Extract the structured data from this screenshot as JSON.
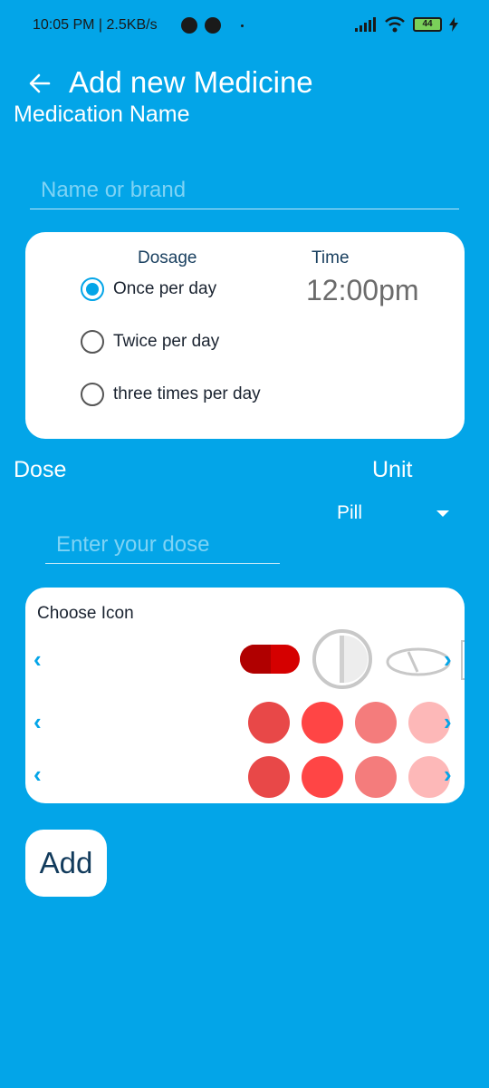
{
  "status_bar": {
    "time_speed": "10:05 PM | 2.5KB/s",
    "battery": "44"
  },
  "header": {
    "title": "Add new Medicine"
  },
  "medication": {
    "label": "Medication Name",
    "placeholder": "Name or brand"
  },
  "dosage_card": {
    "dosage_heading": "Dosage",
    "time_heading": "Time",
    "time_value": "12:00pm",
    "options": [
      "Once per day",
      "Twice per day",
      "three times per day"
    ],
    "selected": "Once per day"
  },
  "dose": {
    "label": "Dose",
    "placeholder": "Enter your dose"
  },
  "unit": {
    "label": "Unit",
    "value": "Pill"
  },
  "icon_card": {
    "heading": "Choose Icon",
    "row_colors": [
      "#E84848",
      "#FF4545",
      "#F47C7C",
      "#FDB8B8"
    ],
    "capsule_color": "#D50000",
    "accent": "#03A5E8"
  },
  "actions": {
    "add_label": "Add"
  }
}
